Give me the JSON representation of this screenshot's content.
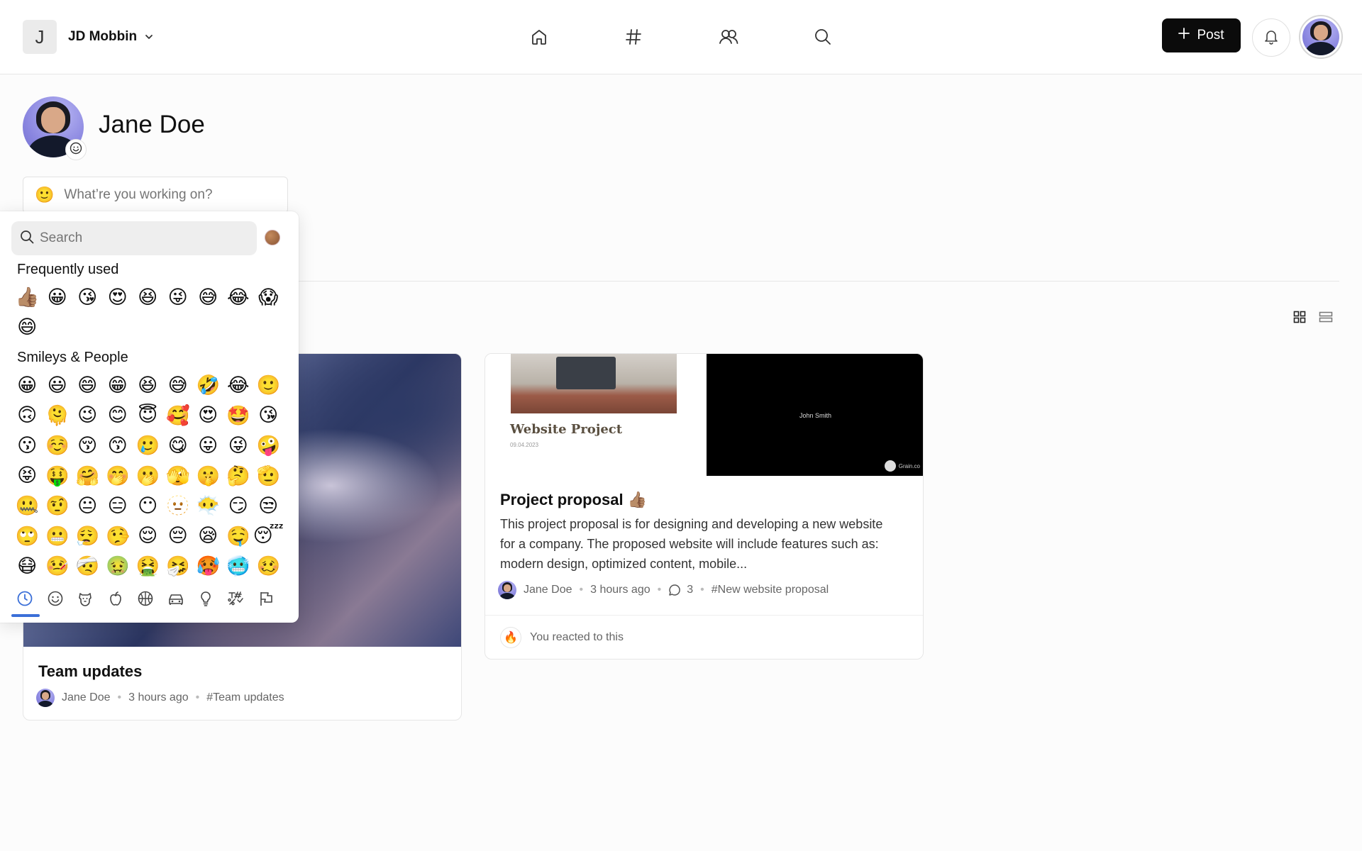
{
  "header": {
    "workspace_initial": "J",
    "workspace_name": "JD Mobbin",
    "post_label": "Post"
  },
  "profile": {
    "name": "Jane Doe",
    "status_placeholder": "What’re you working on?",
    "status_emoji": "🙂"
  },
  "picker": {
    "search_placeholder": "Search",
    "frequent_label": "Frequently used",
    "frequent": [
      "👍🏽",
      "😀",
      "😘",
      "😍",
      "😆",
      "😜",
      "😅",
      "😂",
      "😱",
      "😄"
    ],
    "smileys_label": "Smileys & People",
    "smileys": [
      "😀",
      "😃",
      "😄",
      "😁",
      "😆",
      "😅",
      "🤣",
      "😂",
      "🙂",
      "🙃",
      "🫠",
      "😉",
      "😊",
      "😇",
      "🥰",
      "😍",
      "🤩",
      "😘",
      "😗",
      "☺️",
      "😚",
      "😙",
      "🥲",
      "😋",
      "😛",
      "😜",
      "🤪",
      "😝",
      "🤑",
      "🤗",
      "🤭",
      "🫢",
      "🫣",
      "🤫",
      "🤔",
      "🫡",
      "🤐",
      "🤨",
      "😐",
      "😑",
      "😶",
      "🫥",
      "😶‍🌫️",
      "😏",
      "😒",
      "🙄",
      "😬",
      "😮‍💨",
      "🤥",
      "😌",
      "😔",
      "😪",
      "🤤",
      "😴",
      "😷",
      "🤒",
      "🤕",
      "🤢",
      "🤮",
      "🤧",
      "🥵",
      "🥶",
      "🥴"
    ],
    "categories": [
      "recent",
      "smileys",
      "animals",
      "food",
      "activity",
      "travel",
      "objects",
      "symbols",
      "flags"
    ]
  },
  "cards": {
    "left": {
      "title": "Team updates",
      "author": "Jane Doe",
      "time": "3 hours ago",
      "tag": "#Team updates"
    },
    "right": {
      "thumb_title": "Website Project",
      "thumb_subtitle": "09.04.2023",
      "thumb_presenter": "John Smith",
      "thumb_brand": "Grain.co",
      "title": "Project proposal 👍🏽",
      "description": "This project proposal is for designing and developing a new website for a company. The proposed website will include features such as: modern design, optimized content, mobile...",
      "author": "Jane Doe",
      "time": "3 hours ago",
      "comments": "3",
      "tag": "#New website proposal",
      "reaction_emoji": "🔥",
      "reaction_text": "You reacted to this"
    }
  },
  "colors": {
    "accent": "#3b6fd8",
    "primary_button": "#0b0b0b"
  }
}
